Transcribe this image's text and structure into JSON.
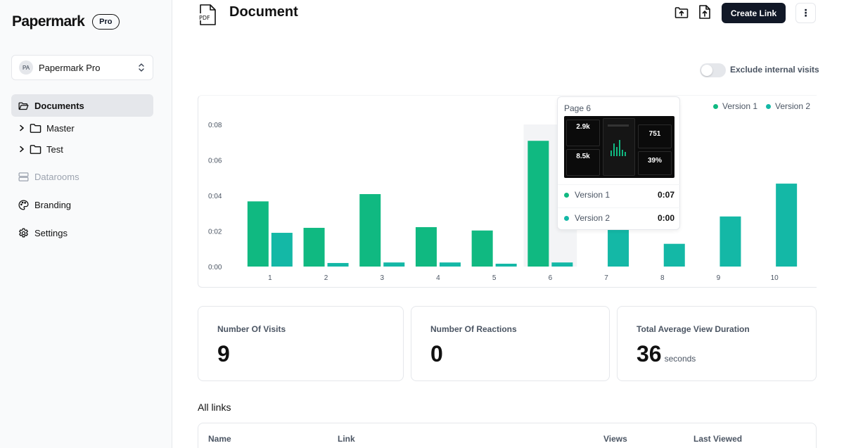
{
  "app": {
    "brand": "Papermark",
    "plan_badge": "Pro"
  },
  "team": {
    "initials": "PA",
    "name": "Papermark Pro"
  },
  "sidebar": {
    "items": [
      {
        "label": "Documents",
        "icon": "folder-open-icon",
        "active": true
      },
      {
        "label": "Datarooms",
        "icon": "server-icon",
        "muted": true
      },
      {
        "label": "Branding",
        "icon": "palette-icon"
      },
      {
        "label": "Settings",
        "icon": "gear-icon"
      }
    ],
    "folders": [
      {
        "label": "Master"
      },
      {
        "label": "Test"
      }
    ]
  },
  "header": {
    "title": "Document",
    "file_type": "PDF",
    "create_link_label": "Create Link",
    "more_label": "⋮"
  },
  "filters": {
    "exclude_internal_label": "Exclude internal visits",
    "exclude_internal_on": false
  },
  "chart_data": {
    "type": "bar",
    "categories": [
      "1",
      "2",
      "3",
      "4",
      "5",
      "6",
      "7",
      "8",
      "9",
      "10"
    ],
    "series": [
      {
        "name": "Version 1",
        "color": "#10b981",
        "values": [
          0.0367,
          0.0218,
          0.0408,
          0.0222,
          0.0203,
          0.0708,
          null,
          null,
          null,
          null
        ]
      },
      {
        "name": "Version 2",
        "color": "#14b8a6",
        "values": [
          0.019,
          0.002,
          0.0023,
          0.0023,
          0.0016,
          0.0023,
          0.0218,
          0.0128,
          0.0282,
          0.0467
        ]
      }
    ],
    "y_ticks": [
      "0:00",
      "0:02",
      "0:04",
      "0:06",
      "0:08"
    ],
    "ylim": [
      0,
      0.08
    ],
    "highlight_category": "6"
  },
  "tooltip": {
    "title": "Page 6",
    "rows": [
      {
        "label": "Version 1",
        "value": "0:07"
      },
      {
        "label": "Version 2",
        "value": "0:00"
      }
    ],
    "thumb": {
      "stat1": "2.9k",
      "stat2": "8.5k",
      "stat3": "751",
      "stat4": "39%"
    }
  },
  "stats": [
    {
      "label": "Number Of Visits",
      "value": "9",
      "unit": ""
    },
    {
      "label": "Number Of Reactions",
      "value": "0",
      "unit": ""
    },
    {
      "label": "Total Average View Duration",
      "value": "36",
      "unit": "seconds"
    }
  ],
  "links_section": {
    "title": "All links",
    "columns": [
      "Name",
      "Link",
      "Views",
      "Last Viewed"
    ]
  }
}
